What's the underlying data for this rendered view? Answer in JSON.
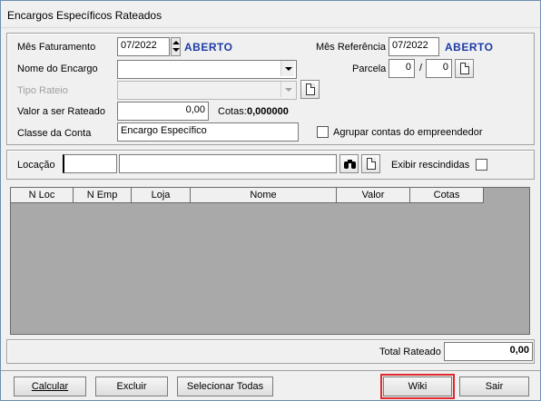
{
  "window": {
    "title": "Encargos Específicos Rateados"
  },
  "form": {
    "mes_faturamento_label": "Mês Faturamento",
    "mes_faturamento_value": "07/2022",
    "mes_faturamento_status": "ABERTO",
    "mes_referencia_label": "Mês Referência",
    "mes_referencia_value": "07/2022",
    "mes_referencia_status": "ABERTO",
    "nome_encargo_label": "Nome do Encargo",
    "nome_encargo_value": "",
    "parcela_label": "Parcela",
    "parcela_atual": "0",
    "parcela_sep": "/",
    "parcela_total": "0",
    "tipo_rateio_label": "Tipo Rateio",
    "tipo_rateio_value": "",
    "valor_rateado_label": "Valor a ser Rateado",
    "valor_rateado_value": "0,00",
    "cotas_label": "Cotas:",
    "cotas_value": "0,000000",
    "classe_conta_label": "Classe da Conta",
    "classe_conta_value": "Encargo Específico",
    "agrupar_label": "Agrupar contas do empreendedor",
    "agrupar_checked": false
  },
  "locacao": {
    "label": "Locação",
    "code_value": "",
    "name_value": "",
    "exibir_rescindidas_label": "Exibir rescindidas",
    "exibir_rescindidas_checked": false
  },
  "grid": {
    "columns": [
      "N Loc",
      "N Emp",
      "Loja",
      "Nome",
      "Valor",
      "Cotas"
    ],
    "rows": []
  },
  "totals": {
    "label": "Total Rateado",
    "value": "0,00"
  },
  "buttons": {
    "calcular": "Calcular",
    "excluir": "Excluir",
    "selecionar_todas": "Selecionar Todas",
    "wiki": "Wiki",
    "sair": "Sair"
  },
  "icons": {
    "spin": "spin-updown-icon",
    "dropdown": "chevron-down-icon",
    "document": "document-icon",
    "search": "binoculars-icon"
  }
}
